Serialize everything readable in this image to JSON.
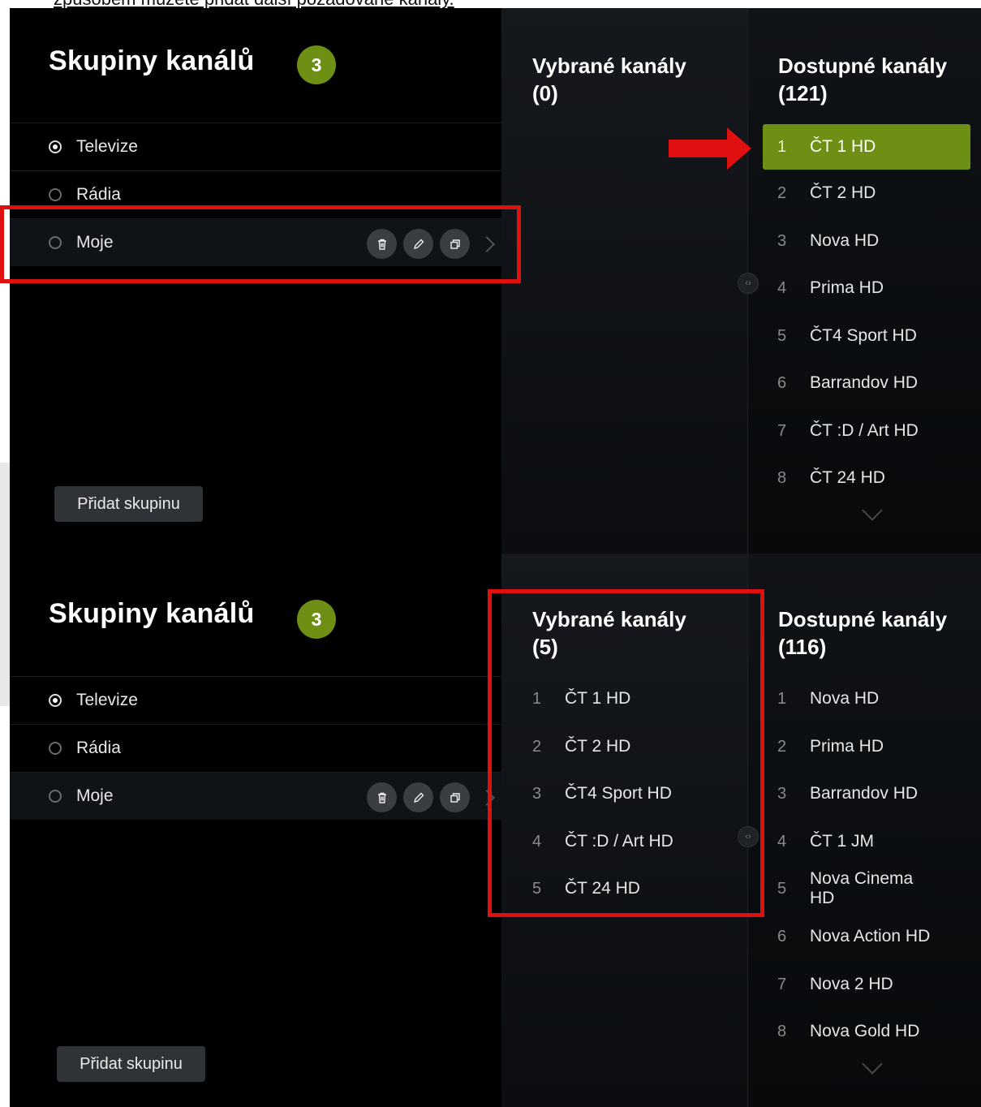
{
  "caption": "způsobem můžete přidat další požadované kanály.",
  "colors": {
    "accent": "#6d8f14",
    "highlight_red": "#e01010"
  },
  "screens": [
    {
      "title": "Skupiny kanálů",
      "badge": "3",
      "groups": [
        {
          "label": "Televize",
          "selected": true
        },
        {
          "label": "Rádia",
          "selected": false
        },
        {
          "label": "Moje",
          "selected": false
        }
      ],
      "group_actions": [
        "trash-icon",
        "pencil-icon",
        "copy-icon",
        "chevron-right-icon"
      ],
      "add_group": "Přidat skupinu",
      "selected_title": "Vybrané kanály",
      "selected_count": "(0)",
      "selected_channels": [],
      "available_title": "Dostupné kanály",
      "available_count": "(121)",
      "available_channels": [
        {
          "num": "1",
          "name": "ČT 1 HD",
          "active": true
        },
        {
          "num": "2",
          "name": "ČT 2 HD"
        },
        {
          "num": "3",
          "name": "Nova HD"
        },
        {
          "num": "4",
          "name": "Prima HD"
        },
        {
          "num": "5",
          "name": "ČT4 Sport HD"
        },
        {
          "num": "6",
          "name": "Barrandov HD"
        },
        {
          "num": "7",
          "name": "ČT :D / Art HD"
        },
        {
          "num": "8",
          "name": "ČT 24 HD"
        }
      ]
    },
    {
      "title": "Skupiny kanálů",
      "badge": "3",
      "groups": [
        {
          "label": "Televize",
          "selected": true
        },
        {
          "label": "Rádia",
          "selected": false
        },
        {
          "label": "Moje",
          "selected": false
        }
      ],
      "group_actions": [
        "trash-icon",
        "pencil-icon",
        "copy-icon",
        "chevron-right-icon"
      ],
      "add_group": "Přidat skupinu",
      "selected_title": "Vybrané kanály",
      "selected_count": "(5)",
      "selected_channels": [
        {
          "num": "1",
          "name": "ČT 1 HD"
        },
        {
          "num": "2",
          "name": "ČT 2 HD"
        },
        {
          "num": "3",
          "name": "ČT4 Sport HD"
        },
        {
          "num": "4",
          "name": "ČT :D / Art HD"
        },
        {
          "num": "5",
          "name": "ČT 24 HD"
        }
      ],
      "available_title": "Dostupné kanály",
      "available_count": "(116)",
      "available_channels": [
        {
          "num": "1",
          "name": "Nova HD"
        },
        {
          "num": "2",
          "name": "Prima HD"
        },
        {
          "num": "3",
          "name": "Barrandov HD"
        },
        {
          "num": "4",
          "name": "ČT 1 JM"
        },
        {
          "num": "5",
          "name": "Nova Cinema HD"
        },
        {
          "num": "6",
          "name": "Nova Action HD"
        },
        {
          "num": "7",
          "name": "Nova 2 HD"
        },
        {
          "num": "8",
          "name": "Nova Gold HD"
        }
      ]
    }
  ]
}
